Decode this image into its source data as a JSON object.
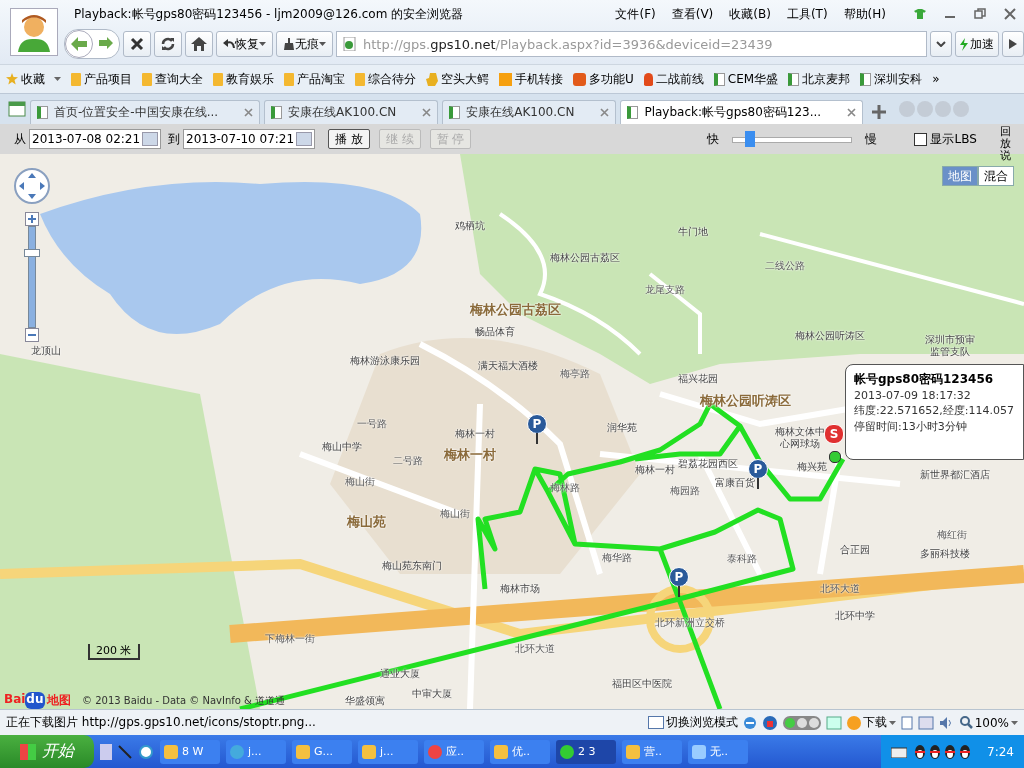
{
  "window": {
    "title": "Playback:帐号gps80密码123456 - ljm2009@126.com 的安全浏览器"
  },
  "menu": [
    "文件(F)",
    "查看(V)",
    "收藏(B)",
    "工具(T)",
    "帮助(H)"
  ],
  "nav": {
    "restore": "恢复",
    "incognito": "无痕",
    "url_host": "http://gps.",
    "url_domain": "gps10.net",
    "url_path": "/Playback.aspx?id=3936&deviceid=23439",
    "speedup": "加速"
  },
  "bookmarks": [
    {
      "label": "收藏",
      "kind": "favorites"
    },
    {
      "label": "产品项目",
      "kind": "folder"
    },
    {
      "label": "查询大全",
      "kind": "folder"
    },
    {
      "label": "教育娱乐",
      "kind": "folder"
    },
    {
      "label": "产品淘宝",
      "kind": "folder"
    },
    {
      "label": "综合待分",
      "kind": "folder"
    },
    {
      "label": "空头大鳄",
      "kind": "hand"
    },
    {
      "label": "手机转接",
      "kind": "app"
    },
    {
      "label": "多功能U",
      "kind": "tao"
    },
    {
      "label": "二战前线",
      "kind": "pin"
    },
    {
      "label": "CEM华盛",
      "kind": "page"
    },
    {
      "label": "北京麦邦",
      "kind": "page"
    },
    {
      "label": "深圳安科",
      "kind": "page"
    },
    {
      "label": "»",
      "kind": "more"
    }
  ],
  "tabs": [
    {
      "label": "首页-位置安全-中国安康在线...",
      "selected": false
    },
    {
      "label": "安康在线AK100.CN",
      "selected": false
    },
    {
      "label": "安康在线AK100.CN",
      "selected": false
    },
    {
      "label": "Playback:帐号gps80密码123...",
      "selected": true
    }
  ],
  "toolbar": {
    "from_label": "从",
    "from": "2013-07-08 02:21",
    "to_label": "到",
    "to": "2013-07-10 07:21",
    "buttons": [
      {
        "label": "播 放",
        "disabled": false
      },
      {
        "label": "继 续",
        "disabled": true
      },
      {
        "label": "暂 停",
        "disabled": true
      }
    ],
    "fast": "快",
    "slow": "慢",
    "speed": {
      "level": 0.15
    },
    "lbs": {
      "label": "显示LBS",
      "checked": false
    },
    "help": "回放说"
  },
  "map": {
    "type_buttons": [
      {
        "label": "地图",
        "selected": true
      },
      {
        "label": "混合",
        "selected": false
      }
    ],
    "labels": [
      {
        "text": "鸡栖坑",
        "kind": "poi"
      },
      {
        "text": "牛门地",
        "kind": "poi"
      },
      {
        "text": "梅林公园古荔区",
        "kind": "poi"
      },
      {
        "text": "梅林公园古荔区",
        "kind": "area"
      },
      {
        "text": "畅品体育",
        "kind": "poi"
      },
      {
        "text": "梅林游泳康乐园",
        "kind": "poi"
      },
      {
        "text": "满天福大酒楼",
        "kind": "poi"
      },
      {
        "text": "梅亭路",
        "kind": "road"
      },
      {
        "text": "龙尾支路",
        "kind": "road"
      },
      {
        "text": "二线公路",
        "kind": "road"
      },
      {
        "text": "梅林公园听涛区",
        "kind": "poi"
      },
      {
        "text": "福兴花园",
        "kind": "poi"
      },
      {
        "text": "梅林公园听涛区",
        "kind": "area"
      },
      {
        "text": "深圳市预审",
        "kind": "poi"
      },
      {
        "text": "监管支队",
        "kind": "poi"
      },
      {
        "text": "润华苑",
        "kind": "poi"
      },
      {
        "text": "梅林一村",
        "kind": "poi"
      },
      {
        "text": "梅林一村",
        "kind": "area"
      },
      {
        "text": "梅林一村",
        "kind": "poi"
      },
      {
        "text": "梅林文体中",
        "kind": "poi"
      },
      {
        "text": "心网球场",
        "kind": "poi"
      },
      {
        "text": "碧荔花园西区",
        "kind": "poi"
      },
      {
        "text": "梅兴苑",
        "kind": "poi"
      },
      {
        "text": "新世界都汇酒店",
        "kind": "poi"
      },
      {
        "text": "梅山中学",
        "kind": "poi"
      },
      {
        "text": "二号路",
        "kind": "road"
      },
      {
        "text": "一号路",
        "kind": "road"
      },
      {
        "text": "梅山街",
        "kind": "road"
      },
      {
        "text": "梅林路",
        "kind": "road"
      },
      {
        "text": "梅园路",
        "kind": "road"
      },
      {
        "text": "富康百货",
        "kind": "poi"
      },
      {
        "text": "梅山苑",
        "kind": "area"
      },
      {
        "text": "梅山街",
        "kind": "road"
      },
      {
        "text": "梅红街",
        "kind": "road"
      },
      {
        "text": "梅华路",
        "kind": "road"
      },
      {
        "text": "泰科路",
        "kind": "road"
      },
      {
        "text": "合正园",
        "kind": "poi"
      },
      {
        "text": "多丽科技楼",
        "kind": "poi"
      },
      {
        "text": "梅山苑东南门",
        "kind": "poi"
      },
      {
        "text": "梅林市场",
        "kind": "poi"
      },
      {
        "text": "北环大道",
        "kind": "road"
      },
      {
        "text": "北环中学",
        "kind": "poi"
      },
      {
        "text": "下梅林一街",
        "kind": "road"
      },
      {
        "text": "北环新洲立交桥",
        "kind": "road"
      },
      {
        "text": "北环大道",
        "kind": "road"
      },
      {
        "text": "通业大厦",
        "kind": "poi"
      },
      {
        "text": "福田区中医院",
        "kind": "poi"
      },
      {
        "text": "中审大厦",
        "kind": "poi"
      },
      {
        "text": "华盛领寓",
        "kind": "poi"
      },
      {
        "text": "龙顶山",
        "kind": "poi"
      }
    ],
    "zoom": {
      "level": 0.75
    },
    "stops": [
      {
        "label": "P"
      },
      {
        "label": "P"
      },
      {
        "label": "P"
      }
    ],
    "start": {
      "label": "S"
    },
    "popup": {
      "title": "帐号gps80密码123456",
      "time": "2013-07-09 18:17:32",
      "coords": "纬度:22.571652,经度:114.057",
      "stay": "停留时间:13小时3分钟"
    },
    "scale": "200 米",
    "logo": {
      "left": "Bai",
      "paw": "du",
      "right": "地图"
    },
    "copyright": "© 2013 Baidu - Data © NavInfo & 道道通"
  },
  "status": {
    "text": "正在下载图片 http://gps.gps10.net/icons/stoptr.png...",
    "mode": "切换浏览模式",
    "download": "下载",
    "zoom": "100%"
  },
  "taskbar": {
    "start": "开始",
    "items": [
      "8 W",
      "j...",
      "G...",
      "j...",
      "应..",
      "优..",
      "2 3",
      "营..",
      "无.."
    ],
    "clock": "7:24"
  }
}
